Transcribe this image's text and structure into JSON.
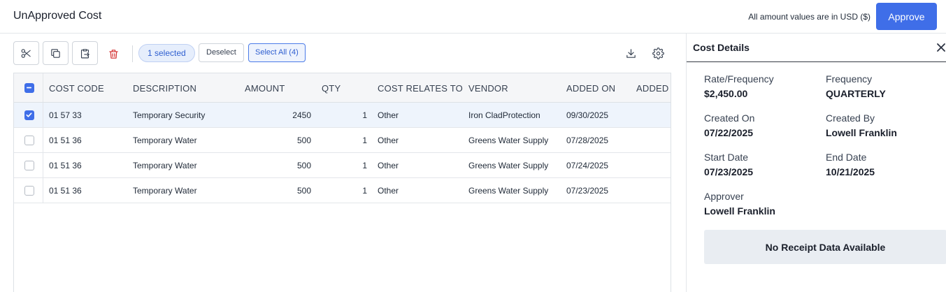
{
  "header": {
    "title": "UnApproved Cost",
    "currency_note": "All amount values are in USD ($)",
    "approve_label": "Approve"
  },
  "toolbar": {
    "selected_label": "1 selected",
    "deselect_label": "Deselect",
    "select_all_label": "Select All (4)",
    "icons": [
      "scissors-icon",
      "copy-icon",
      "paste-icon",
      "trash-icon",
      "download-icon",
      "gear-icon"
    ],
    "trash_color": "#d32f2f"
  },
  "table": {
    "columns": [
      "COST CODE",
      "DESCRIPTION",
      "AMOUNT",
      "QTY",
      "COST RELATES TO",
      "VENDOR",
      "ADDED ON",
      "ADDED"
    ],
    "rows": [
      {
        "selected": true,
        "cost_code": "01 57 33",
        "description": "Temporary Security",
        "amount": "2450",
        "qty": "1",
        "relates_to": "Other",
        "vendor": "Iron CladProtection",
        "added_on": "09/30/2025"
      },
      {
        "selected": false,
        "cost_code": "01 51 36",
        "description": "Temporary Water",
        "amount": "500",
        "qty": "1",
        "relates_to": "Other",
        "vendor": "Greens Water Supply",
        "added_on": "07/28/2025"
      },
      {
        "selected": false,
        "cost_code": "01 51 36",
        "description": "Temporary Water",
        "amount": "500",
        "qty": "1",
        "relates_to": "Other",
        "vendor": "Greens Water Supply",
        "added_on": "07/24/2025"
      },
      {
        "selected": false,
        "cost_code": "01 51 36",
        "description": "Temporary Water",
        "amount": "500",
        "qty": "1",
        "relates_to": "Other",
        "vendor": "Greens Water Supply",
        "added_on": "07/23/2025"
      }
    ]
  },
  "details": {
    "title": "Cost Details",
    "fields": [
      {
        "label": "Rate/Frequency",
        "value": "$2,450.00"
      },
      {
        "label": "Frequency",
        "value": "QUARTERLY"
      },
      {
        "label": "Created On",
        "value": "07/22/2025"
      },
      {
        "label": "Created By",
        "value": "Lowell Franklin"
      },
      {
        "label": "Start Date",
        "value": "07/23/2025"
      },
      {
        "label": "End Date",
        "value": "10/21/2025"
      },
      {
        "label": "Approver",
        "value": "Lowell Franklin"
      }
    ],
    "receipt_message": "No Receipt Data Available"
  },
  "colors": {
    "accent": "#3f6ee8",
    "selected_row": "#eef4fc"
  }
}
